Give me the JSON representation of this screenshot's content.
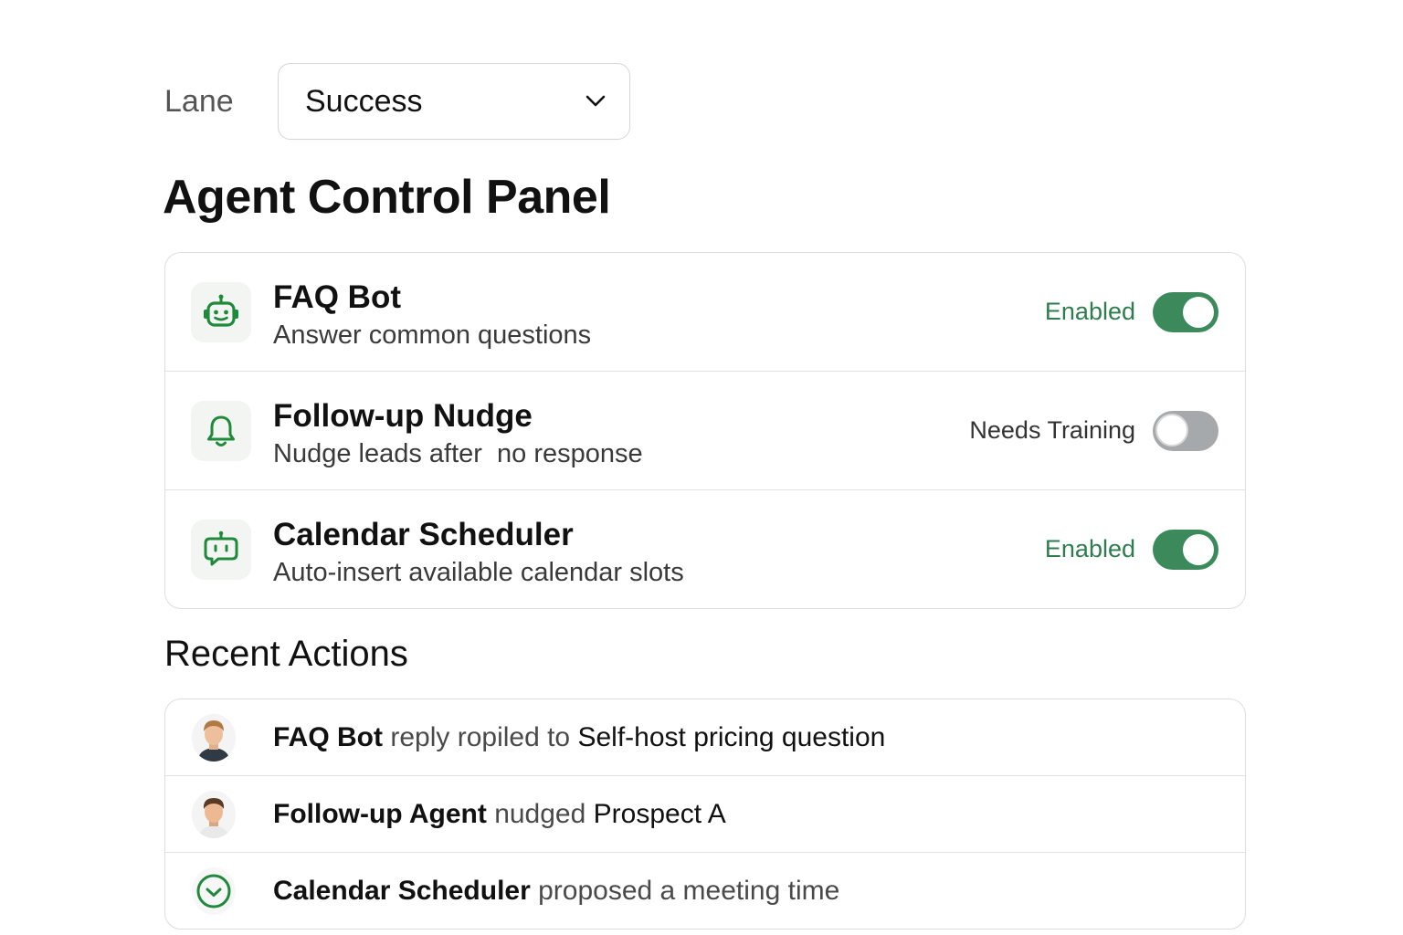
{
  "lane": {
    "label": "Lane",
    "selected": "Success"
  },
  "title": "Agent Control Panel",
  "agents": [
    {
      "name": "FAQ Bot",
      "description": "Answer common questions",
      "status": "Enabled",
      "enabled": true,
      "icon": "robot-icon"
    },
    {
      "name": "Follow-up Nudge",
      "description": "Nudge leads after  no response",
      "status": "Needs Training",
      "enabled": false,
      "icon": "bell-icon"
    },
    {
      "name": "Calendar Scheduler",
      "description": "Auto-insert available calendar slots",
      "status": "Enabled",
      "enabled": true,
      "icon": "chat-bot-icon"
    }
  ],
  "recent_actions_title": "Recent Actions",
  "actions": [
    {
      "actor": "FAQ Bot",
      "verb": "reply ropiled to",
      "object": "Self-host pricing question",
      "icon": "avatar-man-icon"
    },
    {
      "actor": "Follow-up Agent",
      "verb": "nudged",
      "object": "Prospect A",
      "icon": "avatar-man-icon"
    },
    {
      "actor": "Calendar Scheduler",
      "verb": "proposed a meeting time",
      "object": "",
      "icon": "clock-check-icon"
    }
  ],
  "colors": {
    "accent_green": "#2e7d4f",
    "toggle_on": "#3c8a5c",
    "toggle_off": "#a6a9ab",
    "icon_green": "#1f8a3a"
  }
}
